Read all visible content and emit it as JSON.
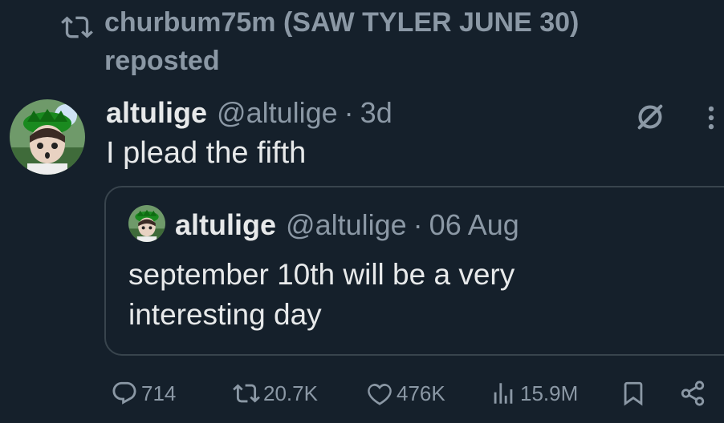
{
  "repost": {
    "icon": "repost-icon",
    "text": "churbum75m (SAW TYLER JUNE 30) reposted"
  },
  "tweet": {
    "avatar": "avatar",
    "name": "altulige",
    "handle": "@altulige",
    "dot": "·",
    "time": "3d",
    "text": "I plead the fifth",
    "icons": [
      "grok-icon",
      "more-icon"
    ]
  },
  "quote": {
    "avatar": "avatar",
    "name": "altulige",
    "handle": "@altulige",
    "dot": "·",
    "time": "06 Aug",
    "text": "september 10th will be a very interesting day"
  },
  "actions": {
    "replies": "714",
    "reposts": "20.7K",
    "likes": "476K",
    "views": "15.9M",
    "icons": [
      "reply-icon",
      "repost-icon",
      "like-icon",
      "views-icon",
      "bookmark-icon",
      "share-icon"
    ]
  },
  "colors": {
    "background": "#15202b",
    "text": "#e7e9ea",
    "muted": "#8b98a5",
    "border": "#38444d"
  }
}
